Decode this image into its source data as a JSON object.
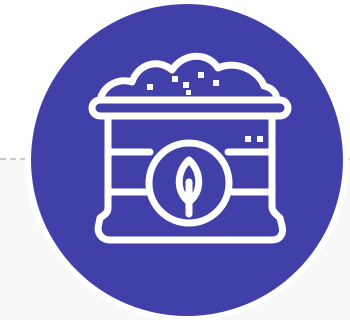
{
  "icon": {
    "name": "organic-soil-sack-icon",
    "circle_color": "#4040a8",
    "ring_color": "#ffffff",
    "stroke_color": "#ffffff"
  },
  "background": {
    "top_color": "#ffffff",
    "bottom_color": "#f8f8f8",
    "divider_color": "#c8c8c8"
  }
}
